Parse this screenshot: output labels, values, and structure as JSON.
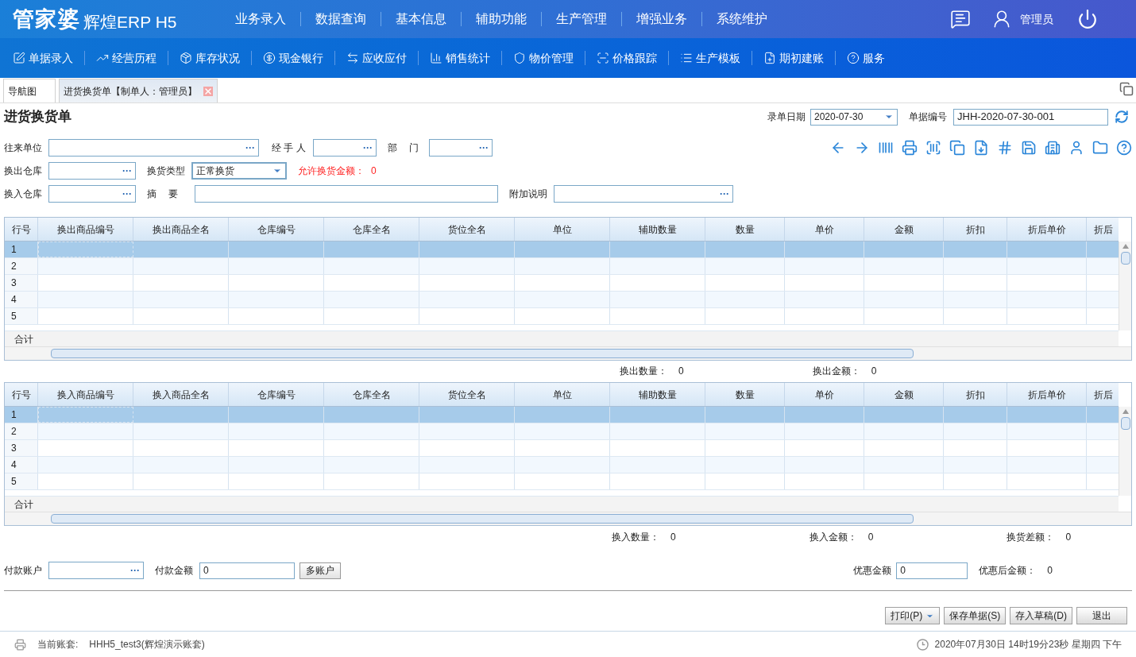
{
  "header": {
    "logo_main": "管家婆",
    "logo_sub": "辉煌ERP H5",
    "nav": [
      "业务录入",
      "数据查询",
      "基本信息",
      "辅助功能",
      "生产管理",
      "增强业务",
      "系统维护"
    ],
    "user": "管理员"
  },
  "toolbar": [
    {
      "label": "单据录入",
      "kind": "edit"
    },
    {
      "label": "经营历程",
      "kind": "trend"
    },
    {
      "label": "库存状况",
      "kind": "box"
    },
    {
      "label": "现金银行",
      "kind": "yen"
    },
    {
      "label": "应收应付",
      "kind": "exchange"
    },
    {
      "label": "销售统计",
      "kind": "chart"
    },
    {
      "label": "物价管理",
      "kind": "shield"
    },
    {
      "label": "价格跟踪",
      "kind": "focus"
    },
    {
      "label": "生产模板",
      "kind": "list"
    },
    {
      "label": "期初建账",
      "kind": "ledger"
    },
    {
      "label": "服务",
      "kind": "help"
    }
  ],
  "tabs": [
    {
      "label": "导航图",
      "selected": false,
      "closable": false
    },
    {
      "label": "进货换货单【制单人：管理员】",
      "selected": true,
      "closable": true
    }
  ],
  "form": {
    "title": "进货换货单",
    "date_label": "录单日期",
    "date_value": "2020-07-30",
    "number_label": "单据编号",
    "number_value": "JHH-2020-07-30-001",
    "partner_label": "往来单位",
    "handler_label": "经 手 人",
    "dept_label": "部　 门",
    "out_wh_label": "换出仓库",
    "type_label": "换货类型",
    "type_value": "正常换货",
    "allow_label": "允许换货金额：",
    "allow_value": "0",
    "in_wh_label": "换入仓库",
    "summary_label": "摘　 要",
    "note_label": "附加说明",
    "ellipsis": "···"
  },
  "grids": [
    {
      "columns": [
        "行号",
        "换出商品编号",
        "换出商品全名",
        "仓库编号",
        "仓库全名",
        "货位全名",
        "单位",
        "辅助数量",
        "数量",
        "单价",
        "金额",
        "折扣",
        "折后单价",
        "折后"
      ],
      "rows": [
        {
          "number": "1",
          "selected": true
        },
        {
          "number": "2",
          "selected": false
        },
        {
          "number": "3",
          "selected": false
        },
        {
          "number": "4",
          "selected": false
        },
        {
          "number": "5",
          "selected": false
        }
      ],
      "total_label": "合计",
      "totals": [
        {
          "label": "换出数量：",
          "value": "0"
        },
        {
          "label": "换出金额：",
          "value": "0"
        }
      ]
    },
    {
      "columns": [
        "行号",
        "换入商品编号",
        "换入商品全名",
        "仓库编号",
        "仓库全名",
        "货位全名",
        "单位",
        "辅助数量",
        "数量",
        "单价",
        "金额",
        "折扣",
        "折后单价",
        "折后"
      ],
      "rows": [
        {
          "number": "1",
          "selected": true
        },
        {
          "number": "2",
          "selected": false
        },
        {
          "number": "3",
          "selected": false
        },
        {
          "number": "4",
          "selected": false
        },
        {
          "number": "5",
          "selected": false
        }
      ],
      "total_label": "合计",
      "totals": [
        {
          "label": "换入数量：",
          "value": "0"
        },
        {
          "label": "换入金额：",
          "value": "0"
        },
        {
          "label": "换货差额：",
          "value": "0"
        }
      ]
    }
  ],
  "payment": {
    "account_label": "付款账户",
    "amount_label": "付款金额",
    "amount_value": "0",
    "multi_button": "多账户",
    "discount_label": "优惠金额",
    "discount_value": "0",
    "after_label": "优惠后金额：",
    "after_value": "0"
  },
  "buttons": [
    "打印(P)",
    "保存单据(S)",
    "存入草稿(D)",
    "退出"
  ],
  "status_bar": {
    "account_label": "当前账套:",
    "account_value": "HHH5_test3(辉煌演示账套)",
    "datetime": "2020年07月30日 14时19分23秒 星期四 下午"
  }
}
